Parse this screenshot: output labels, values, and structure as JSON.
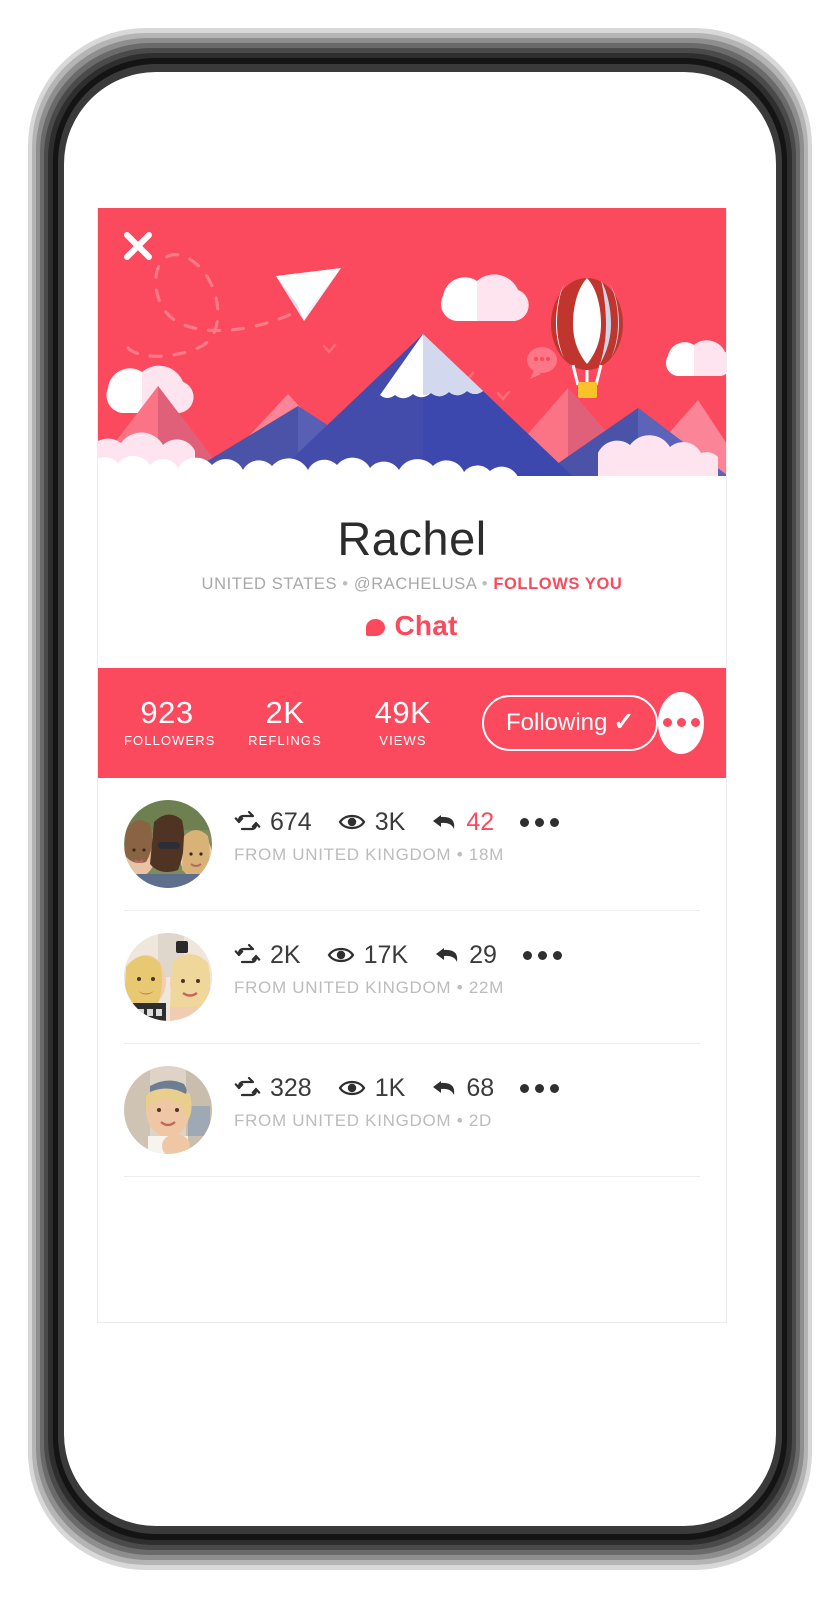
{
  "theme": {
    "accent": "#fb4a5d",
    "mountain_blue": "#4a53a8",
    "text_dark": "#2c2c2c",
    "text_muted": "#a8a8a8"
  },
  "header": {
    "close_icon": "close-icon",
    "illustration": "mountains-clouds-paper-plane-hot-air-balloon"
  },
  "profile": {
    "name": "Rachel",
    "location": "UNITED STATES",
    "handle": "@RACHELUSA",
    "relationship": "FOLLOWS YOU",
    "separator": "•",
    "chat_label": "Chat"
  },
  "stats": {
    "items": [
      {
        "value": "923",
        "label": "FOLLOWERS"
      },
      {
        "value": "2K",
        "label": "REFLINGS"
      },
      {
        "value": "49K",
        "label": "VIEWS"
      }
    ],
    "follow_button": {
      "label": "Following",
      "check": "✓",
      "state": "following"
    },
    "more_button": "more-options"
  },
  "posts": [
    {
      "avatar": "three-women-outdoors-photo",
      "reflings": "674",
      "views": "3K",
      "replies": "42",
      "replies_highlighted": true,
      "from": "FROM UNITED KINGDOM",
      "separator": "•",
      "time": "18M"
    },
    {
      "avatar": "two-women-selfie-photo",
      "reflings": "2K",
      "views": "17K",
      "replies": "29",
      "replies_highlighted": false,
      "from": "FROM UNITED KINGDOM",
      "separator": "•",
      "time": "22M"
    },
    {
      "avatar": "woman-street-photo",
      "reflings": "328",
      "views": "1K",
      "replies": "68",
      "replies_highlighted": false,
      "from": "FROM UNITED KINGDOM",
      "separator": "•",
      "time": "2D"
    }
  ]
}
